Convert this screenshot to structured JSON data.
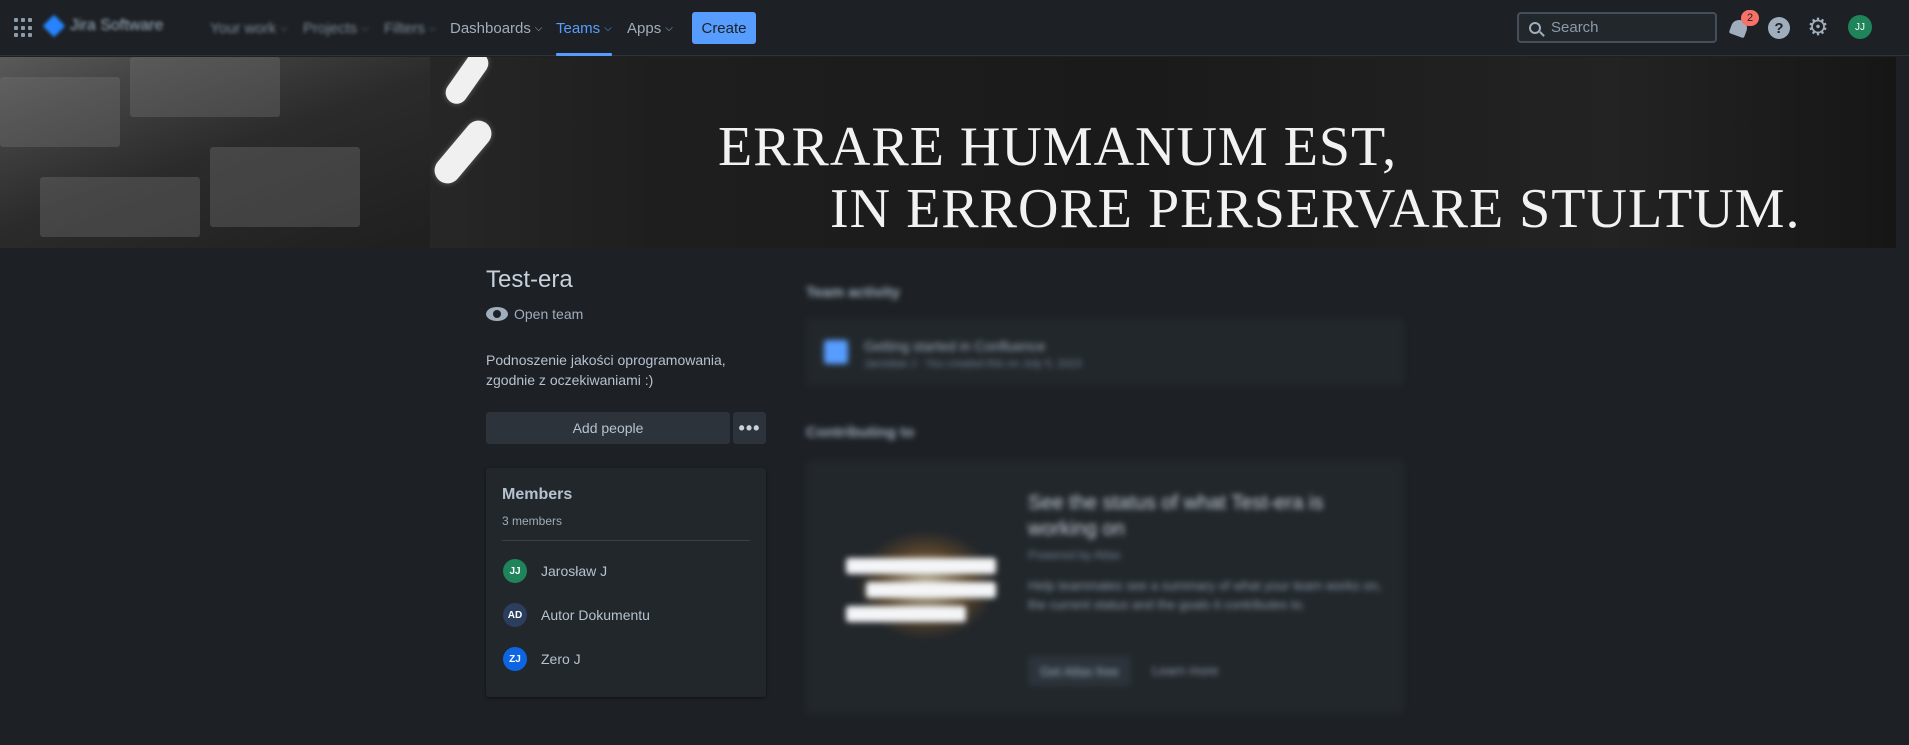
{
  "nav": {
    "product": "Jira Software",
    "items": [
      "Your work",
      "Projects",
      "Filters",
      "Dashboards",
      "Teams",
      "Apps"
    ],
    "create_label": "Create",
    "search_placeholder": "Search",
    "notifications_count": "2",
    "user_initials": "JJ"
  },
  "banner": {
    "line1": "ERRARE HUMANUM EST,",
    "line2": "IN ERRORE PERSERVARE STULTUM."
  },
  "team": {
    "name": "Test-era",
    "visibility": "Open team",
    "description": "Podnoszenie jakości oprogramowania, zgodnie z oczekiwaniami :)",
    "add_people_label": "Add people",
    "more_label": "•••"
  },
  "members": {
    "title": "Members",
    "count": "3 members",
    "list": [
      {
        "initials": "JJ",
        "name": "Jarosław J",
        "color": "#1f845a"
      },
      {
        "initials": "AD",
        "name": "Autor Dokumentu",
        "color": "#2c3e5d"
      },
      {
        "initials": "ZJ",
        "name": "Zero J",
        "color": "#0c66e4"
      }
    ]
  },
  "activity": {
    "title": "Team activity",
    "item_title": "Getting started in Confluence",
    "item_sub": "Jarosław J · You created this on July 5, 2023"
  },
  "contributing": {
    "title": "Contributing to",
    "heading": "See the status of what Test-era is working on",
    "powered": "Powered by Atlas",
    "body": "Help teammates see a summary of what your team works on, the current status and the goals it contributes to.",
    "button": "Get Atlas free",
    "link": "Learn more"
  },
  "colors": {
    "accent": "#579dff",
    "background": "#1d2125",
    "badge": "#f87168"
  }
}
